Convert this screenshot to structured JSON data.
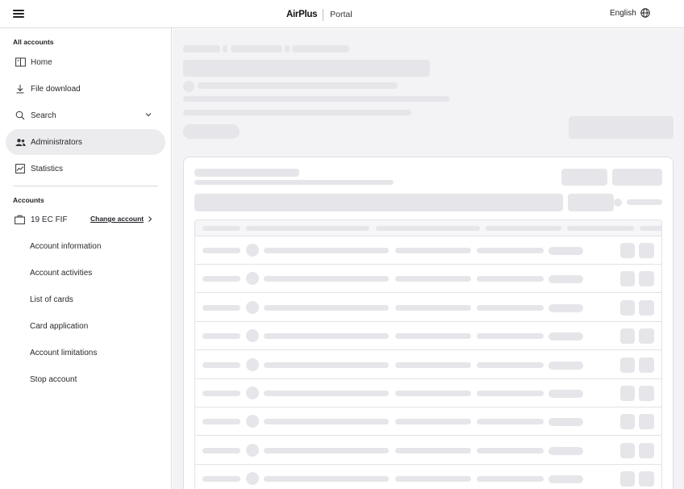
{
  "header": {
    "menu_icon": "hamburger-menu-icon",
    "brand_logo": "AirPlus",
    "brand_product": "Portal",
    "language": "English",
    "language_icon": "globe-icon"
  },
  "sidebar": {
    "all_accounts_heading": "All accounts",
    "items": [
      {
        "label": "Home",
        "icon": "book-open-icon"
      },
      {
        "label": "File download",
        "icon": "download-icon"
      },
      {
        "label": "Search",
        "icon": "search-icon"
      },
      {
        "label": "Administrators",
        "icon": "users-icon"
      },
      {
        "label": "Statistics",
        "icon": "chart-line-icon"
      }
    ],
    "active_item": "Administrators",
    "accounts_heading": "Accounts",
    "account": {
      "name": "19 EC FIF",
      "icon": "briefcase-icon",
      "change_label": "Change account"
    },
    "account_items": [
      {
        "label": "Account information"
      },
      {
        "label": "Account activities"
      },
      {
        "label": "List of cards"
      },
      {
        "label": "Card application"
      },
      {
        "label": "Account limitations"
      },
      {
        "label": "Stop account"
      }
    ]
  },
  "main": {
    "state": "loading"
  },
  "colors": {
    "skeleton": "#e6e6ea",
    "main_background": "#f3f3f6",
    "active_nav": "#ececee",
    "border": "#dcdce0"
  }
}
